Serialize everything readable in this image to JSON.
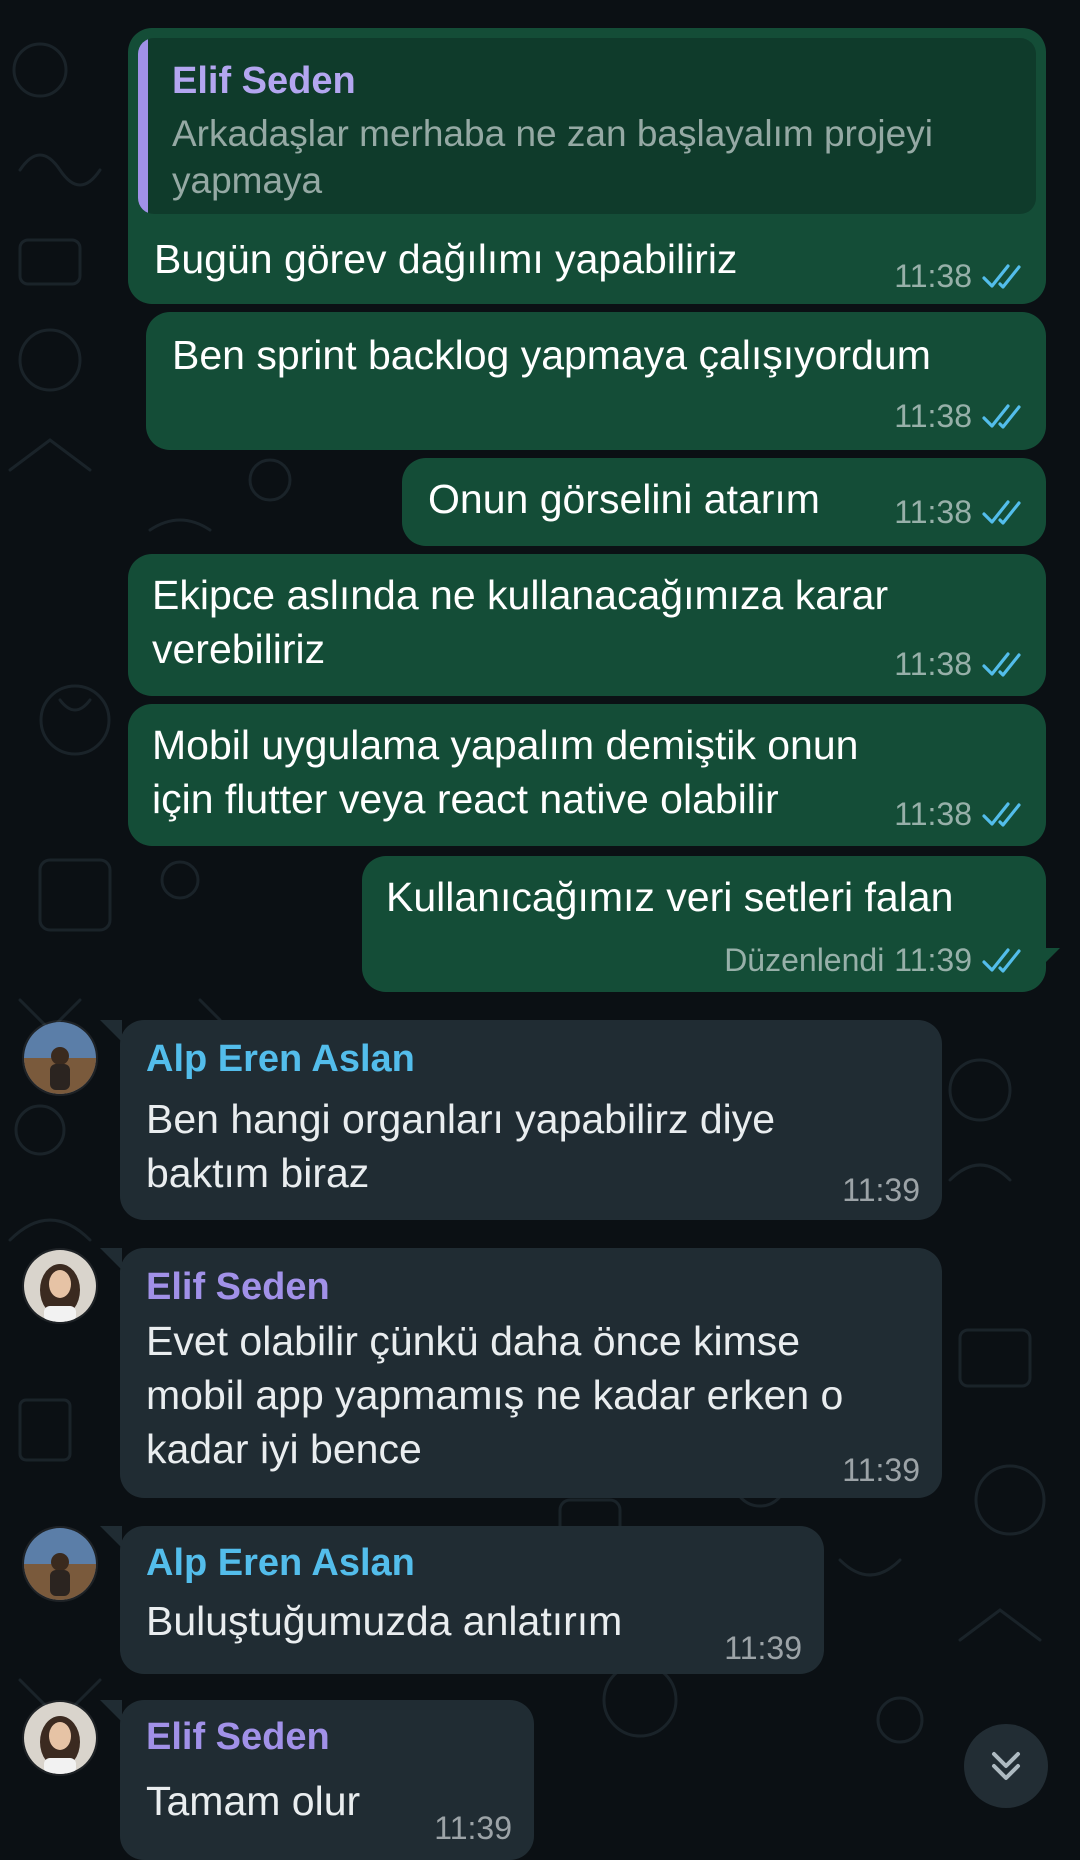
{
  "colors": {
    "background": "#0b1014",
    "outgoing_bubble": "#144d37",
    "incoming_bubble": "#202c33",
    "read_ticks": "#53bdeb",
    "sender_alp": "#53bdeb",
    "sender_elif": "#a191e8"
  },
  "messages": [
    {
      "direction": "outgoing",
      "reply": {
        "sender": "Elif Seden",
        "text": "Arkadaşlar merhaba ne zan başlayalım projeyi yapmaya"
      },
      "text": "Bugün görev dağılımı yapabiliriz",
      "time": "11:38",
      "status_icon": "double-check-read-icon"
    },
    {
      "direction": "outgoing",
      "text": "Ben sprint backlog yapmaya çalışıyordum",
      "time": "11:38",
      "status_icon": "double-check-read-icon"
    },
    {
      "direction": "outgoing",
      "text": "Onun görselini atarım",
      "time": "11:38",
      "status_icon": "double-check-read-icon"
    },
    {
      "direction": "outgoing",
      "lines": [
        "Ekipce aslında ne kullanacağımıza karar",
        "verebiliriz"
      ],
      "time": "11:38",
      "status_icon": "double-check-read-icon"
    },
    {
      "direction": "outgoing",
      "lines": [
        "Mobil uygulama yapalım demiştik onun",
        "için flutter veya react native olabilir"
      ],
      "time": "11:38",
      "status_icon": "double-check-read-icon"
    },
    {
      "direction": "outgoing",
      "text": "Kullanıcağımız veri setleri falan",
      "edited_label": "Düzenlendi",
      "time": "11:39",
      "status_icon": "double-check-read-icon"
    },
    {
      "direction": "incoming",
      "sender": "Alp Eren Aslan",
      "lines": [
        "Ben hangi organları yapabilirz diye",
        "baktım biraz"
      ],
      "time": "11:39"
    },
    {
      "direction": "incoming",
      "sender": "Elif Seden",
      "lines": [
        "Evet olabilir çünkü daha önce kimse",
        "mobil app yapmamış ne kadar erken o",
        "kadar iyi bence"
      ],
      "time": "11:39"
    },
    {
      "direction": "incoming",
      "sender": "Alp Eren Aslan",
      "text": "Buluştuğumuzda anlatırım",
      "time": "11:39"
    },
    {
      "direction": "incoming",
      "sender": "Elif Seden",
      "text": "Tamam olur",
      "time": "11:39"
    }
  ],
  "scroll_button": {
    "icon": "double-chevron-down-icon"
  }
}
